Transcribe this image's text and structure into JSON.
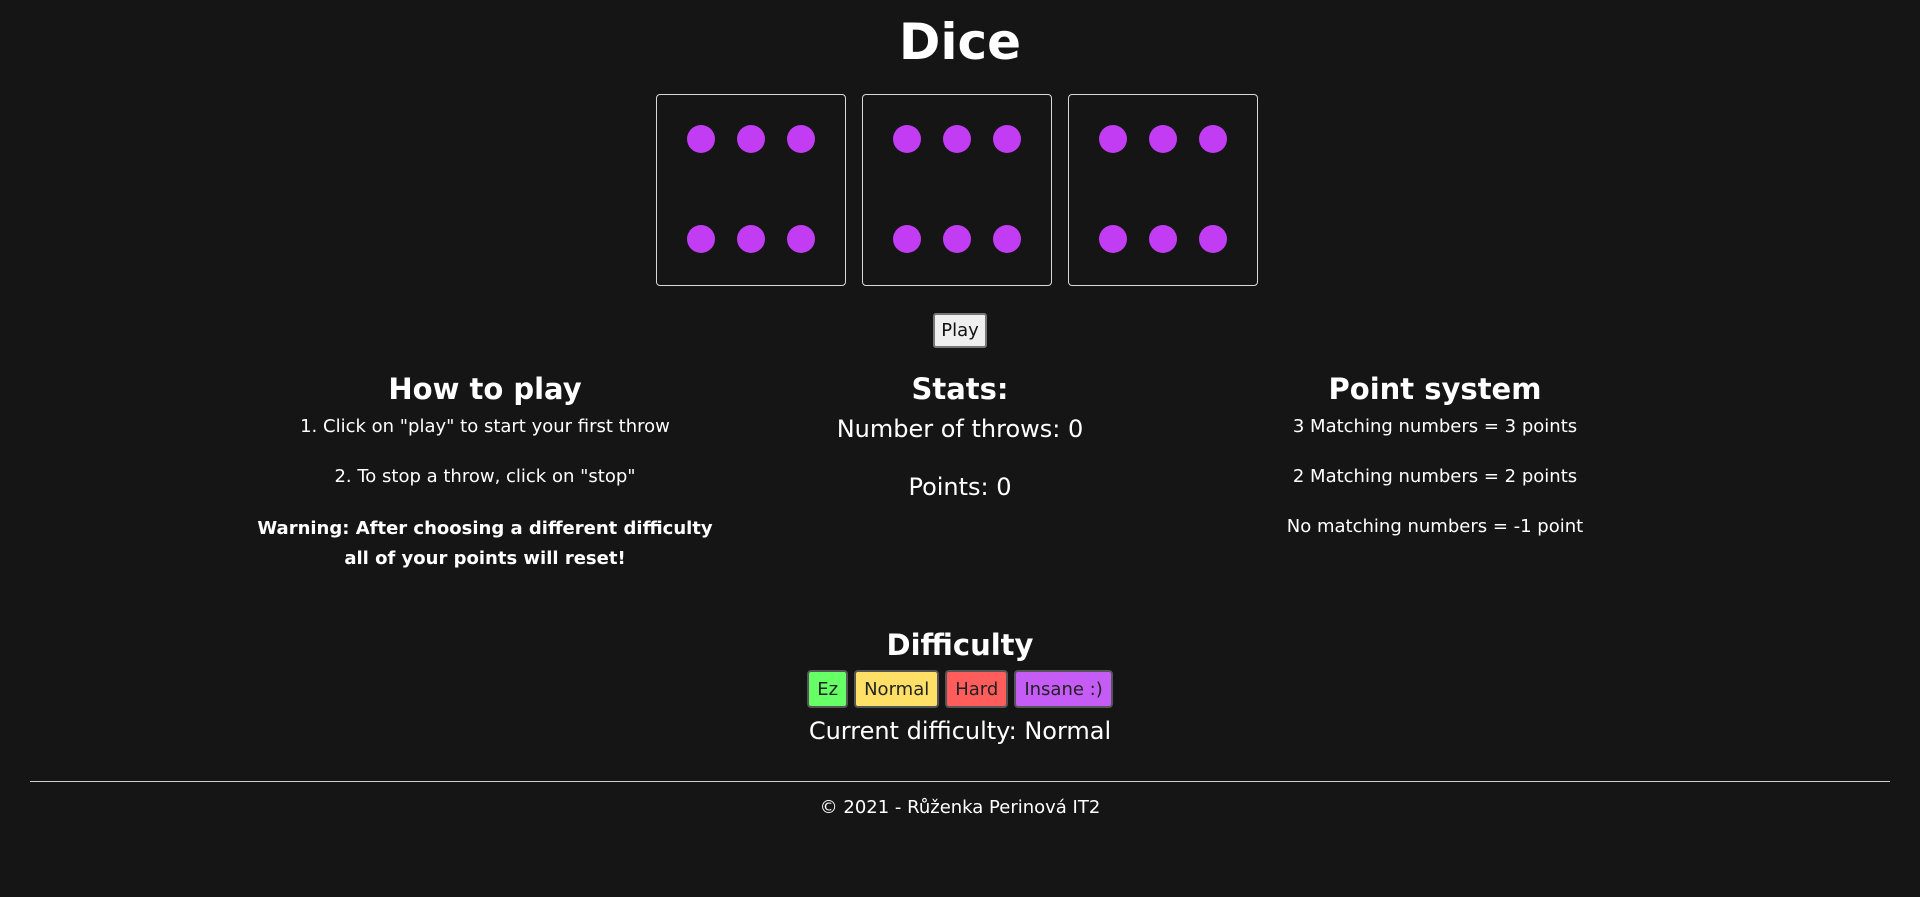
{
  "title": "Dice",
  "dice": [
    {
      "value": 6
    },
    {
      "value": 6
    },
    {
      "value": 6
    }
  ],
  "colors": {
    "background": "#151515",
    "pip": "#c13cf2",
    "die_border": "#d9d9d9"
  },
  "play_button": {
    "label": "Play"
  },
  "how_to_play": {
    "heading": "How to play",
    "step1": "1. Click on \"play\" to start your first throw",
    "step2": "2. To stop a throw, click on \"stop\"",
    "warning_line1": "Warning: After choosing a different difficulty",
    "warning_line2": "all of your points will reset!"
  },
  "stats": {
    "heading": "Stats:",
    "throws_label": "Number of throws: ",
    "throws_value": "0",
    "points_label": "Points: ",
    "points_value": "0"
  },
  "point_system": {
    "heading": "Point system",
    "rule1": "3 Matching numbers = 3 points",
    "rule2": "2 Matching numbers = 2 points",
    "rule3": "No matching numbers = -1 point"
  },
  "difficulty": {
    "heading": "Difficulty",
    "options": [
      {
        "label": "Ez",
        "color": "#66ff66"
      },
      {
        "label": "Normal",
        "color": "#ffe066"
      },
      {
        "label": "Hard",
        "color": "#ff5c5c"
      },
      {
        "label": "Insane :)",
        "color": "#c45cf5"
      }
    ],
    "current_label": "Current difficulty: ",
    "current_value": "Normal"
  },
  "footer": {
    "text": "© 2021 - Růženka Perinová IT2"
  }
}
